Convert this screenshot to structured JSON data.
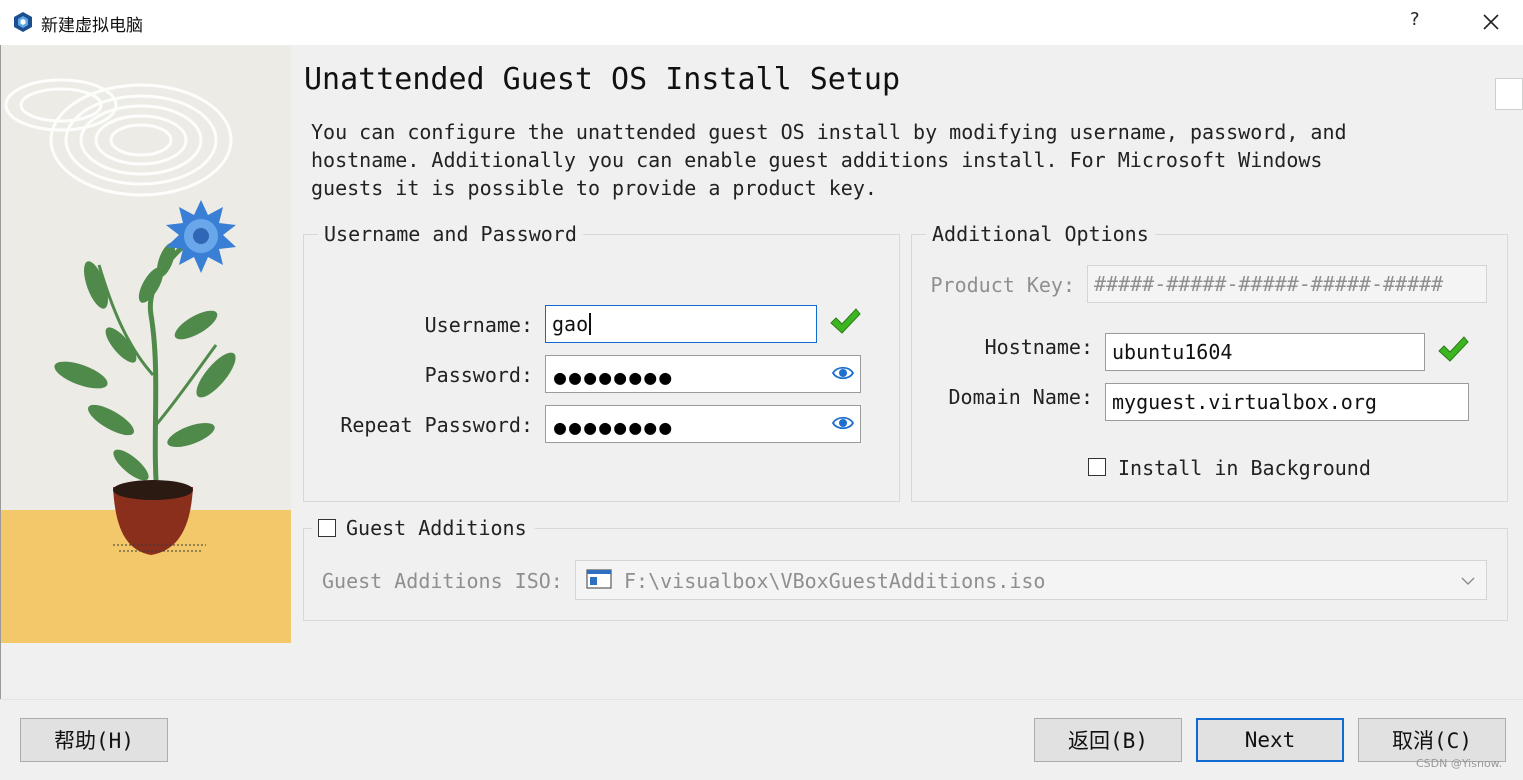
{
  "window": {
    "title": "新建虚拟电脑",
    "help_glyph": "?",
    "icons": [
      "virtualbox-app-icon",
      "close-icon"
    ]
  },
  "page": {
    "title": "Unattended Guest OS Install Setup",
    "description": "You can configure the unattended guest OS install by modifying username, password, and hostname. Additionally you can enable guest additions install. For Microsoft Windows guests it is possible to provide a product key."
  },
  "credentials": {
    "legend": "Username and Password",
    "username_label": "Username:",
    "username_value": "gao",
    "password_label": "Password:",
    "password_mask": "●●●●●●●●",
    "repeat_label": "Repeat Password:",
    "repeat_mask": "●●●●●●●●"
  },
  "options": {
    "legend": "Additional Options",
    "product_key_label": "Product Key:",
    "product_key_placeholder": "#####-#####-#####-#####-#####",
    "hostname_label": "Hostname:",
    "hostname_value": "ubuntu1604",
    "domain_label": "Domain Name:",
    "domain_value": "myguest.virtualbox.org",
    "install_bg_label": "Install in Background",
    "install_bg_checked": false
  },
  "guest_additions": {
    "legend": "Guest Additions",
    "checked": false,
    "iso_label": "Guest Additions ISO:",
    "iso_value": "F:\\visualbox\\VBoxGuestAdditions.iso"
  },
  "footer": {
    "help_label": "帮助(H)",
    "back_label": "返回(B)",
    "next_label": "Next",
    "cancel_label": "取消(C)"
  },
  "colors": {
    "accent": "#0f6bd0",
    "check_green": "#3cb521",
    "sidebar_floor": "#f2c86a",
    "flower_blue": "#3a7fd6",
    "leaf_green": "#4f8a4a",
    "pot_red": "#8b2f1d"
  },
  "watermark": "CSDN @Yisnow."
}
